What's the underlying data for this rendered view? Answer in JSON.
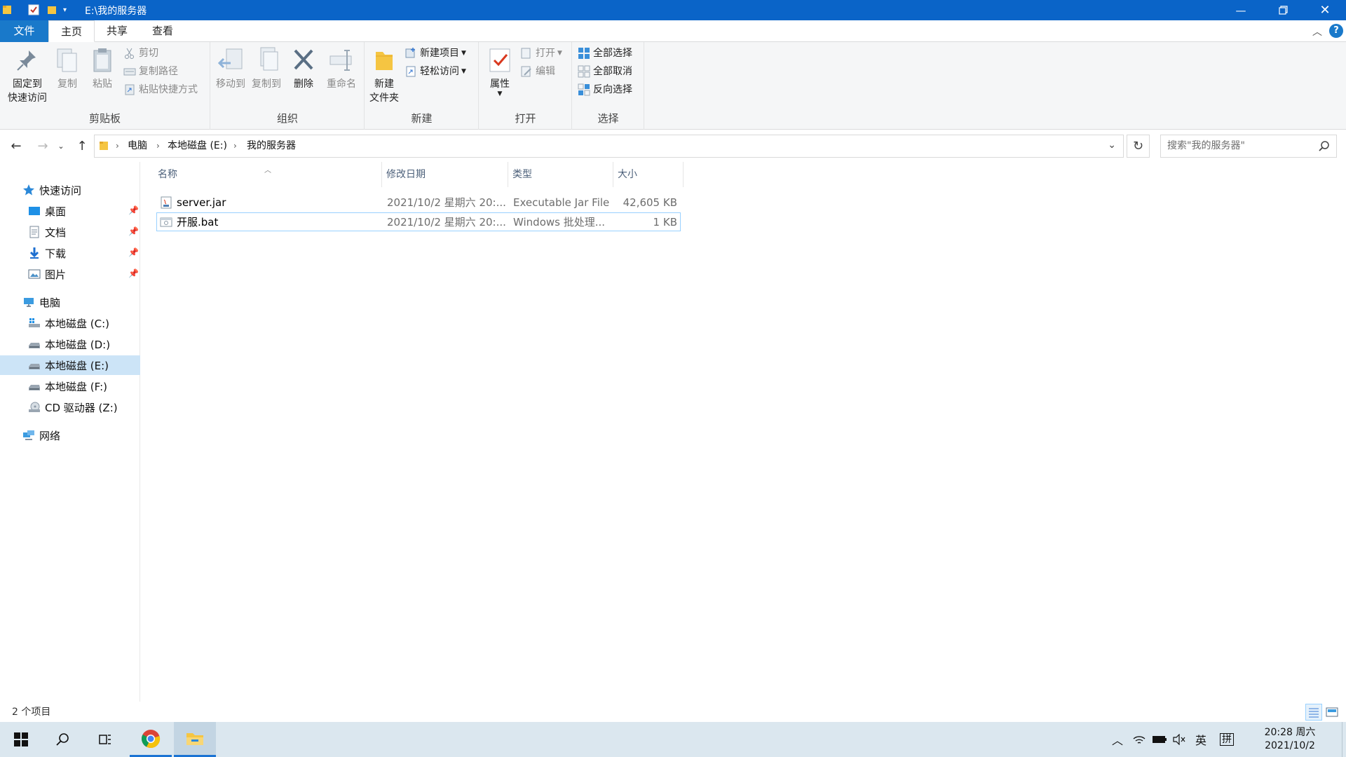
{
  "window": {
    "title": "E:\\我的服务器",
    "minimize_icon": "minimize-icon",
    "maximize_icon": "restore-icon",
    "close_icon": "close-icon"
  },
  "ribbon_tabs": [
    {
      "label": "文件"
    },
    {
      "label": "主页"
    },
    {
      "label": "共享"
    },
    {
      "label": "查看"
    }
  ],
  "ribbon": {
    "clipboard": {
      "group": "剪贴板",
      "pin_l1": "固定到",
      "pin_l2": "快速访问",
      "copy": "复制",
      "paste": "粘贴",
      "cut": "剪切",
      "copy_path": "复制路径",
      "paste_shortcut": "粘贴快捷方式"
    },
    "organize": {
      "group": "组织",
      "move_to": "移动到",
      "copy_to": "复制到",
      "delete": "删除",
      "rename": "重命名"
    },
    "new": {
      "group": "新建",
      "new_folder_l1": "新建",
      "new_folder_l2": "文件夹",
      "new_item": "新建项目",
      "easy_access": "轻松访问"
    },
    "open": {
      "group": "打开",
      "properties": "属性",
      "open": "打开",
      "edit": "编辑"
    },
    "select": {
      "group": "选择",
      "select_all": "全部选择",
      "select_none": "全部取消",
      "invert": "反向选择"
    }
  },
  "address": {
    "crumbs": [
      "电脑",
      "本地磁盘 (E:)",
      "我的服务器"
    ],
    "search_placeholder": "搜索\"我的服务器\""
  },
  "nav": {
    "quick_access": "快速访问",
    "quick_items": [
      {
        "label": "桌面"
      },
      {
        "label": "文档"
      },
      {
        "label": "下载"
      },
      {
        "label": "图片"
      }
    ],
    "this_pc": "电脑",
    "drives": [
      {
        "label": "本地磁盘 (C:)"
      },
      {
        "label": "本地磁盘 (D:)"
      },
      {
        "label": "本地磁盘 (E:)"
      },
      {
        "label": "本地磁盘 (F:)"
      },
      {
        "label": "CD 驱动器 (Z:)"
      }
    ],
    "network": "网络"
  },
  "columns": {
    "name": "名称",
    "date": "修改日期",
    "type": "类型",
    "size": "大小"
  },
  "files": [
    {
      "name": "server.jar",
      "date": "2021/10/2 星期六 20:...",
      "type": "Executable Jar File",
      "size": "42,605 KB"
    },
    {
      "name": "开服.bat",
      "date": "2021/10/2 星期六 20:...",
      "type": "Windows 批处理...",
      "size": "1 KB"
    }
  ],
  "status": {
    "count": "2 个项目"
  },
  "taskbar": {
    "lang": "英",
    "ime": "拼",
    "time": "20:28 周六",
    "date": "2021/10/2"
  },
  "colors": {
    "titlebar": "#0a64c8",
    "file_tab": "#1979ca",
    "selection": "#cce4f7",
    "taskbar": "#dbe7ef"
  }
}
